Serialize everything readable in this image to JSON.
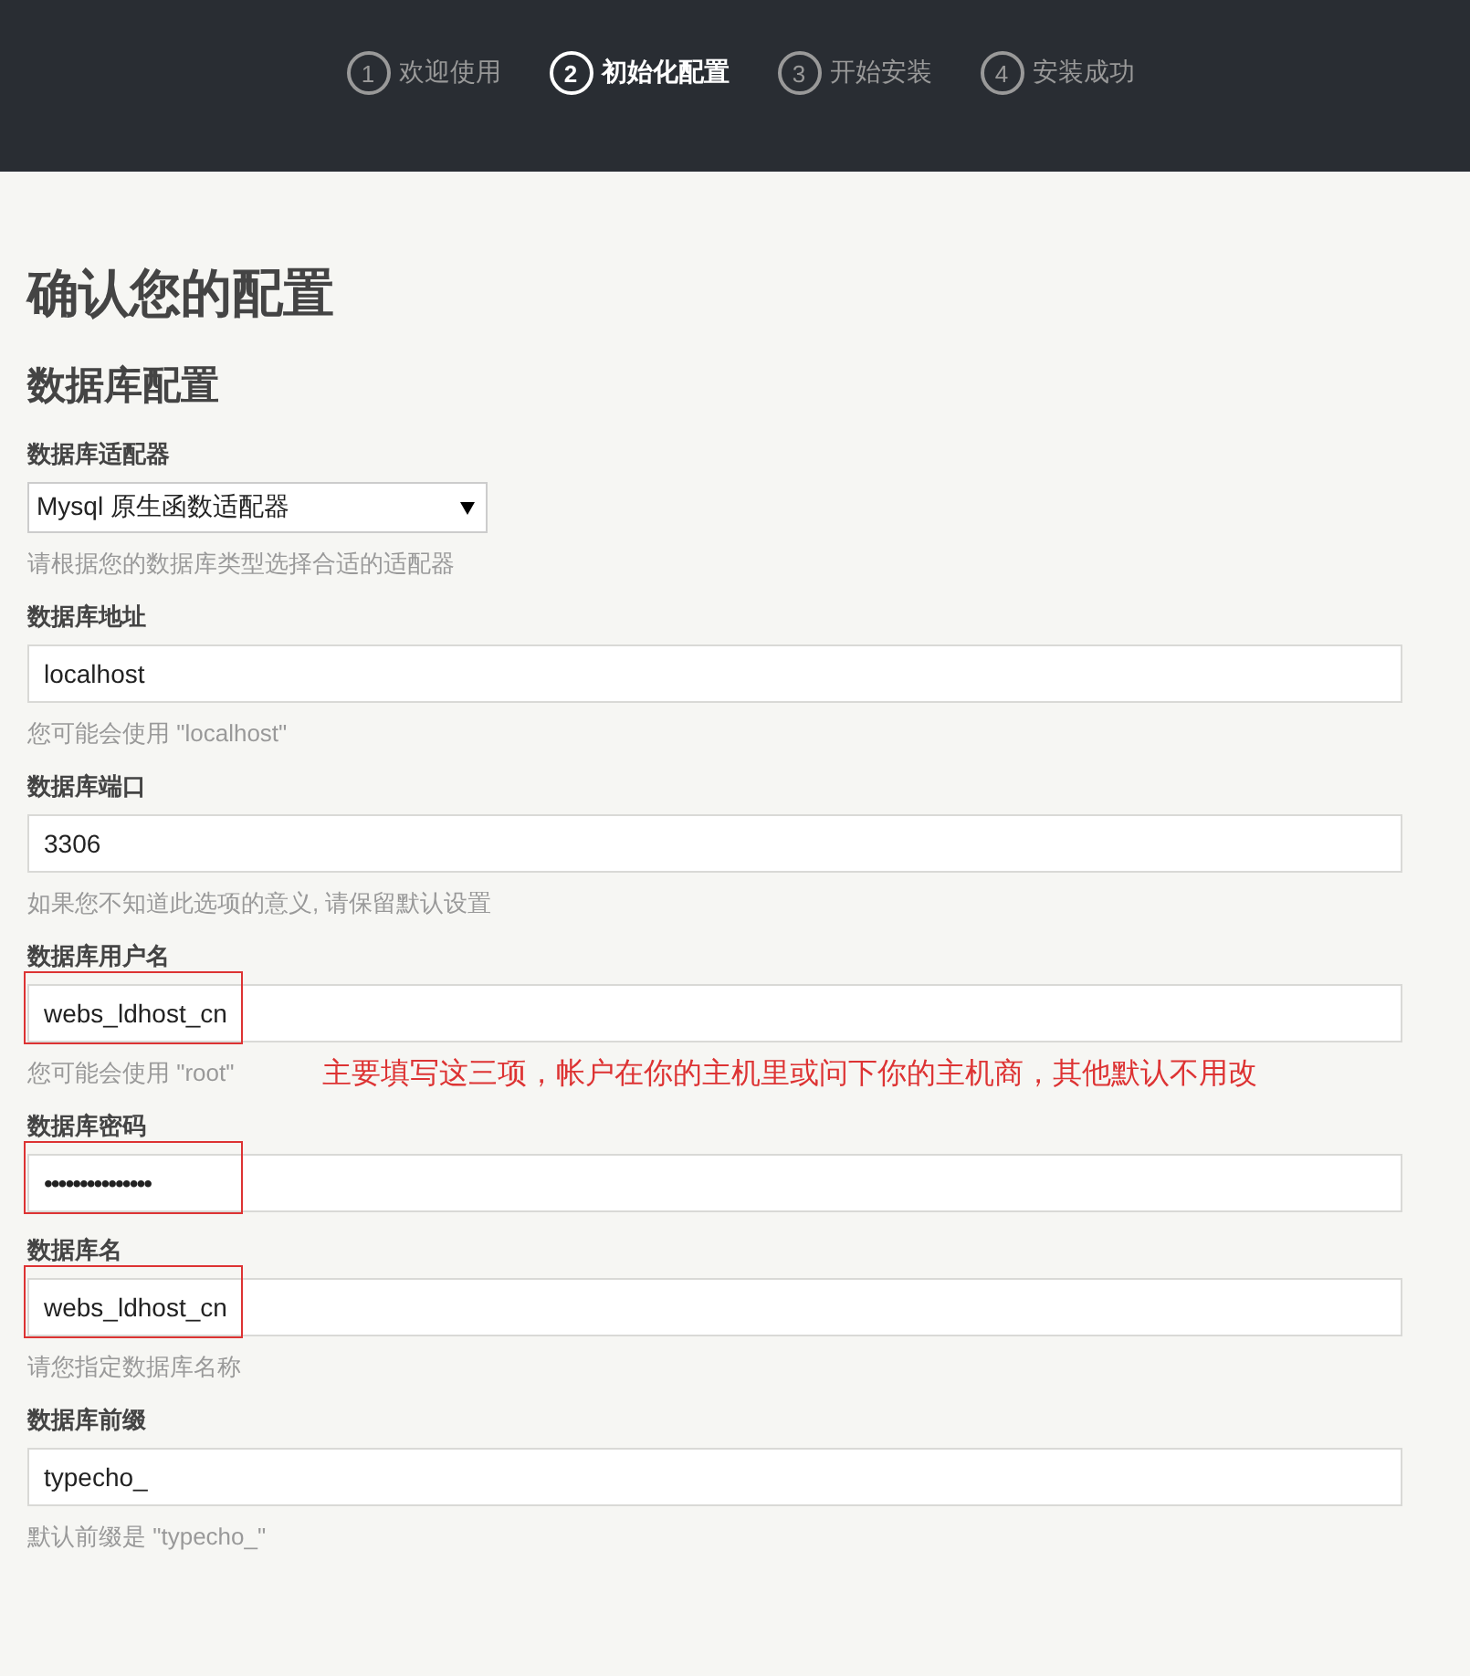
{
  "steps": [
    {
      "number": "1",
      "label": "欢迎使用",
      "selected": false
    },
    {
      "number": "2",
      "label": "初始化配置",
      "selected": true
    },
    {
      "number": "3",
      "label": "开始安装",
      "selected": false
    },
    {
      "number": "4",
      "label": "安装成功",
      "selected": false
    }
  ],
  "title": "确认您的配置",
  "section": "数据库配置",
  "fields": [
    {
      "kind": "select",
      "label": "数据库适配器",
      "value": "Mysql 原生函数适配器",
      "help": "请根据您的数据库类型选择合适的适配器",
      "highlighted": false
    },
    {
      "kind": "text",
      "label": "数据库地址",
      "value": "localhost",
      "help": "您可能会使用 \"localhost\"",
      "highlighted": false
    },
    {
      "kind": "text",
      "label": "数据库端口",
      "value": "3306",
      "help": "如果您不知道此选项的意义, 请保留默认设置",
      "highlighted": false
    },
    {
      "kind": "text",
      "label": "数据库用户名",
      "value": "webs_ldhost_cn",
      "help": "您可能会使用 \"root\"",
      "highlighted": true,
      "note": "主要填写这三项，帐户在你的主机里或问下你的主机商，其他默认不用改"
    },
    {
      "kind": "password",
      "label": "数据库密码",
      "value": "•••••••••••••••",
      "highlighted": true
    },
    {
      "kind": "text",
      "label": "数据库名",
      "value": "webs_ldhost_cn",
      "help": "请您指定数据库名称",
      "highlighted": true
    },
    {
      "kind": "text",
      "label": "数据库前缀",
      "value": "typecho_",
      "help": "默认前缀是 \"typecho_\"",
      "highlighted": false
    }
  ]
}
